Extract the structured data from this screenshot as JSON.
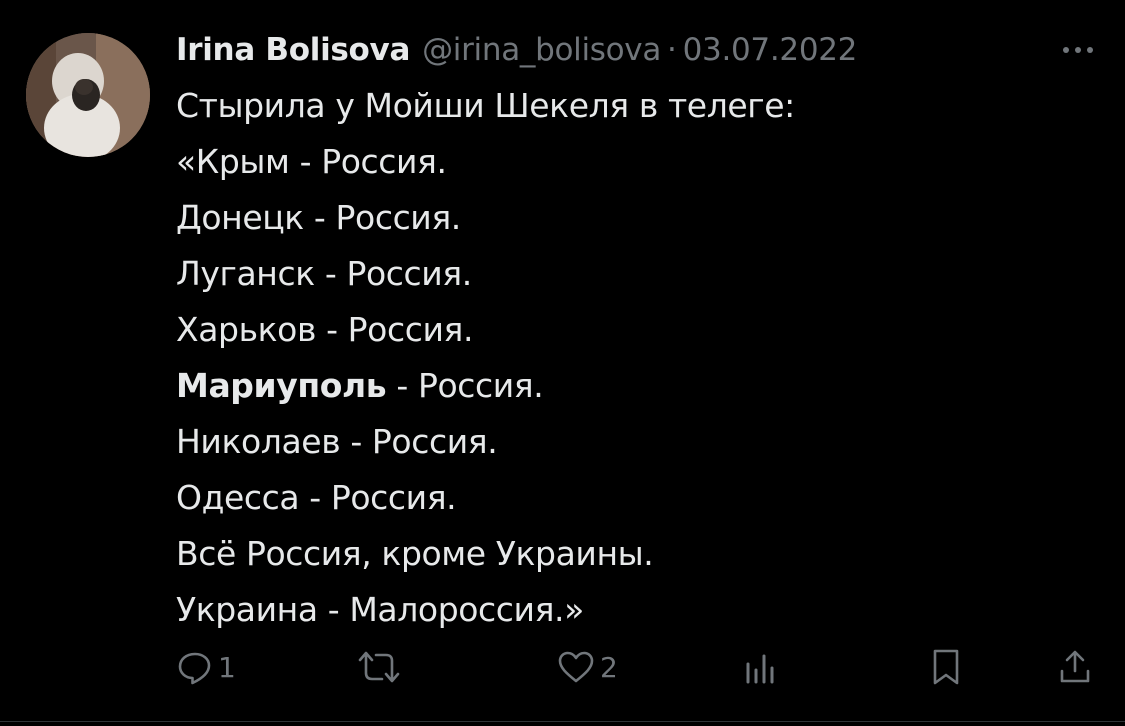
{
  "tweet": {
    "author": {
      "name": "Irina Bolisova",
      "handle": "@irina_bolisova",
      "separator": "·",
      "date": "03.07.2022"
    },
    "more_icon": "ellipsis-icon",
    "lines": [
      {
        "text": "Стырила у Мойши Шекеля в телеге:"
      },
      {
        "text": "«Крым - Россия."
      },
      {
        "text": "Донецк - Россия."
      },
      {
        "text": "Луганск - Россия."
      },
      {
        "text": "Харьков - Россия."
      },
      {
        "bold": "Мариуполь",
        "rest": " - Россия."
      },
      {
        "text": "Николаев - Россия."
      },
      {
        "text": "Одесса - Россия."
      },
      {
        "text": "Всё Россия, кроме Украины."
      },
      {
        "text": "Украина - Малороссия.»"
      }
    ],
    "actions": {
      "reply": {
        "icon": "reply-icon",
        "count": "1"
      },
      "retweet": {
        "icon": "retweet-icon",
        "count": ""
      },
      "like": {
        "icon": "heart-icon",
        "count": "2"
      },
      "views": {
        "icon": "bar-chart-icon",
        "count": ""
      },
      "bookmark": {
        "icon": "bookmark-icon"
      },
      "share": {
        "icon": "share-icon"
      }
    },
    "colors": {
      "background": "#000000",
      "text": "#e7e9ea",
      "muted": "#71767b"
    }
  }
}
